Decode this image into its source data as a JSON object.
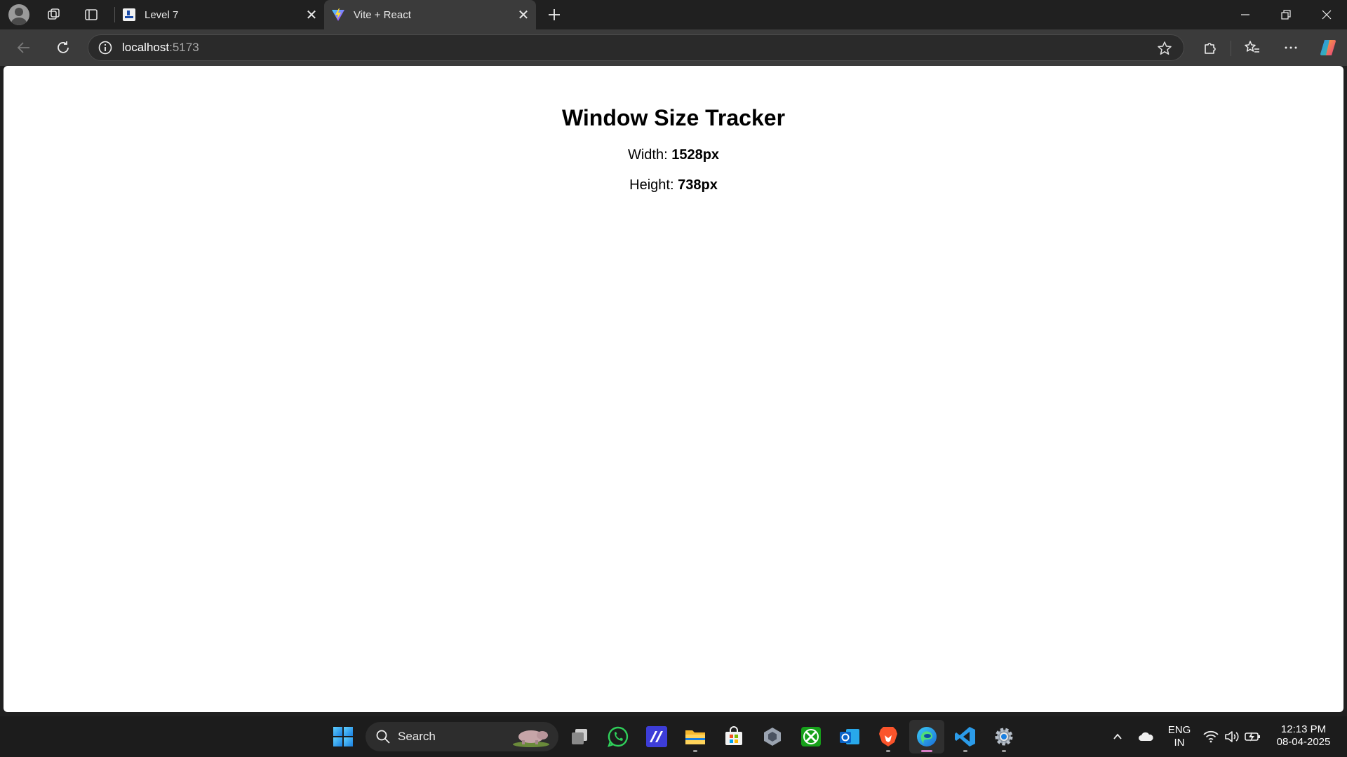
{
  "browser": {
    "tabs": [
      {
        "title": "Level 7",
        "active": false,
        "favicon": "document-favicon"
      },
      {
        "title": "Vite + React",
        "active": true,
        "favicon": "vite-favicon"
      }
    ],
    "address": {
      "host": "localhost",
      "port": ":5173"
    }
  },
  "page": {
    "title": "Window Size Tracker",
    "width_label": "Width:",
    "width_value": "1528px",
    "height_label": "Height:",
    "height_value": "738px"
  },
  "taskbar": {
    "search_label": "Search",
    "apps": [
      "start",
      "search",
      "task-view",
      "whatsapp",
      "visual-studio",
      "file-explorer",
      "microsoft-store",
      "unity",
      "xbox",
      "outlook",
      "brave",
      "edge",
      "vscode",
      "settings"
    ],
    "language_line1": "ENG",
    "language_line2": "IN",
    "time": "12:13 PM",
    "date": "08-04-2025"
  },
  "colors": {
    "chrome_dark": "#202020",
    "toolbar": "#3b3b3b",
    "page_bg": "#ffffff",
    "taskbar": "#1c1c1c"
  }
}
